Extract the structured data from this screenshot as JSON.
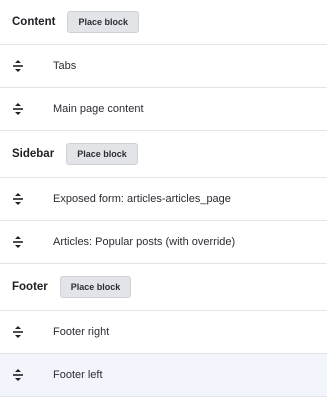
{
  "regions": [
    {
      "title": "Content",
      "button_label": "Place block",
      "blocks": [
        {
          "label": "Tabs"
        },
        {
          "label": "Main page content"
        }
      ]
    },
    {
      "title": "Sidebar",
      "button_label": "Place block",
      "blocks": [
        {
          "label": "Exposed form: articles-articles_page"
        },
        {
          "label": "Articles: Popular posts (with override)"
        }
      ]
    },
    {
      "title": "Footer",
      "button_label": "Place block",
      "blocks": [
        {
          "label": "Footer right"
        },
        {
          "label": "Footer left"
        }
      ]
    }
  ],
  "icons": {
    "drag_handle": "drag-handle-icon"
  },
  "colors": {
    "border": "#e3e4e8",
    "button_bg": "#e3e4e8",
    "highlight_row": "#f2f6fc"
  }
}
